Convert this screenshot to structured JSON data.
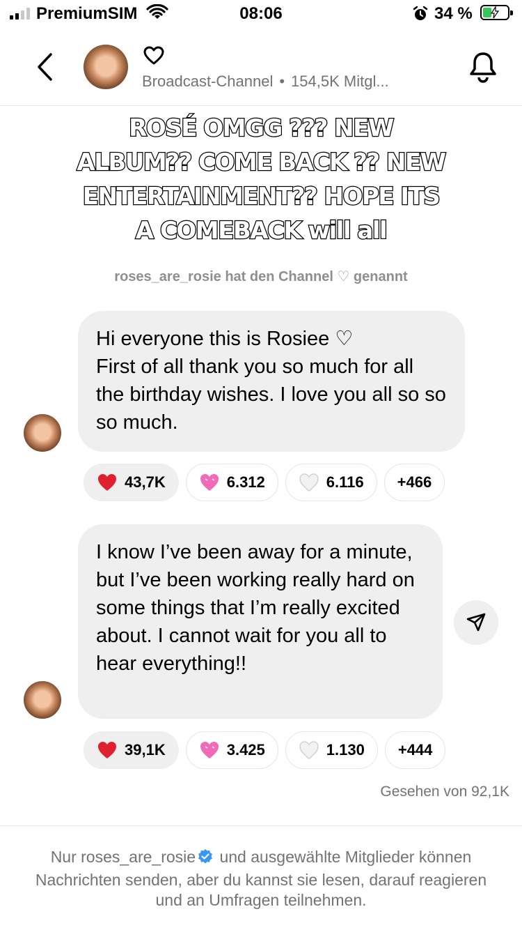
{
  "status_bar": {
    "carrier": "PremiumSIM",
    "time": "08:06",
    "battery_percent": "34 %",
    "battery_level": 0.34
  },
  "header": {
    "subtitle_type": "Broadcast-Channel",
    "subtitle_separator": "•",
    "subtitle_members": "154,5K Mitgl..."
  },
  "overlay_text": "ROSÉ OMGG ??? NEW ALBUM?? COME BACK ?? NEW ENTERTAINMENT?? HOPE ITS A COMEBACK will all",
  "system_note": {
    "user": "roses_are_rosie",
    "text": "hat den Channel ♡ genannt"
  },
  "messages": [
    {
      "text": "Hi everyone this is Rosiee ♡\nFirst of all thank you so much for all the birthday wishes. I love you all so so so much.",
      "reactions": [
        {
          "emoji": "red-heart",
          "count": "43,7K"
        },
        {
          "emoji": "pink-heart",
          "count": "6.312"
        },
        {
          "emoji": "white-heart",
          "count": "6.116"
        },
        {
          "emoji": "more",
          "count": "+466"
        }
      ]
    },
    {
      "text": "I know I’ve been away for a minute, but I’ve been working really hard on some things that I’m really excited about. I cannot wait for you all to hear everything!!",
      "reactions": [
        {
          "emoji": "red-heart",
          "count": "39,1K"
        },
        {
          "emoji": "pink-heart",
          "count": "3.425"
        },
        {
          "emoji": "white-heart",
          "count": "1.130"
        },
        {
          "emoji": "more",
          "count": "+444"
        }
      ]
    }
  ],
  "seen_by": "Gesehen von 92,1K",
  "footer": {
    "prefix": "Nur",
    "user": "roses_are_rosie",
    "text": "und ausgewählte Mitglieder können Nachrichten senden, aber du kannst sie lesen, darauf reagieren und an Umfragen teilnehmen."
  },
  "colors": {
    "bubble_bg": "#efefef",
    "secondary_text": "#737373",
    "verified_blue": "#3897f0",
    "battery_green": "#34c759",
    "red_heart": "#e0202e",
    "pink_heart": "#f06ab8"
  },
  "icons": [
    "back-chevron-icon",
    "heart-outline-icon",
    "bell-icon",
    "share-paper-plane-icon",
    "verified-badge-icon",
    "wifi-icon",
    "alarm-icon",
    "battery-icon"
  ]
}
